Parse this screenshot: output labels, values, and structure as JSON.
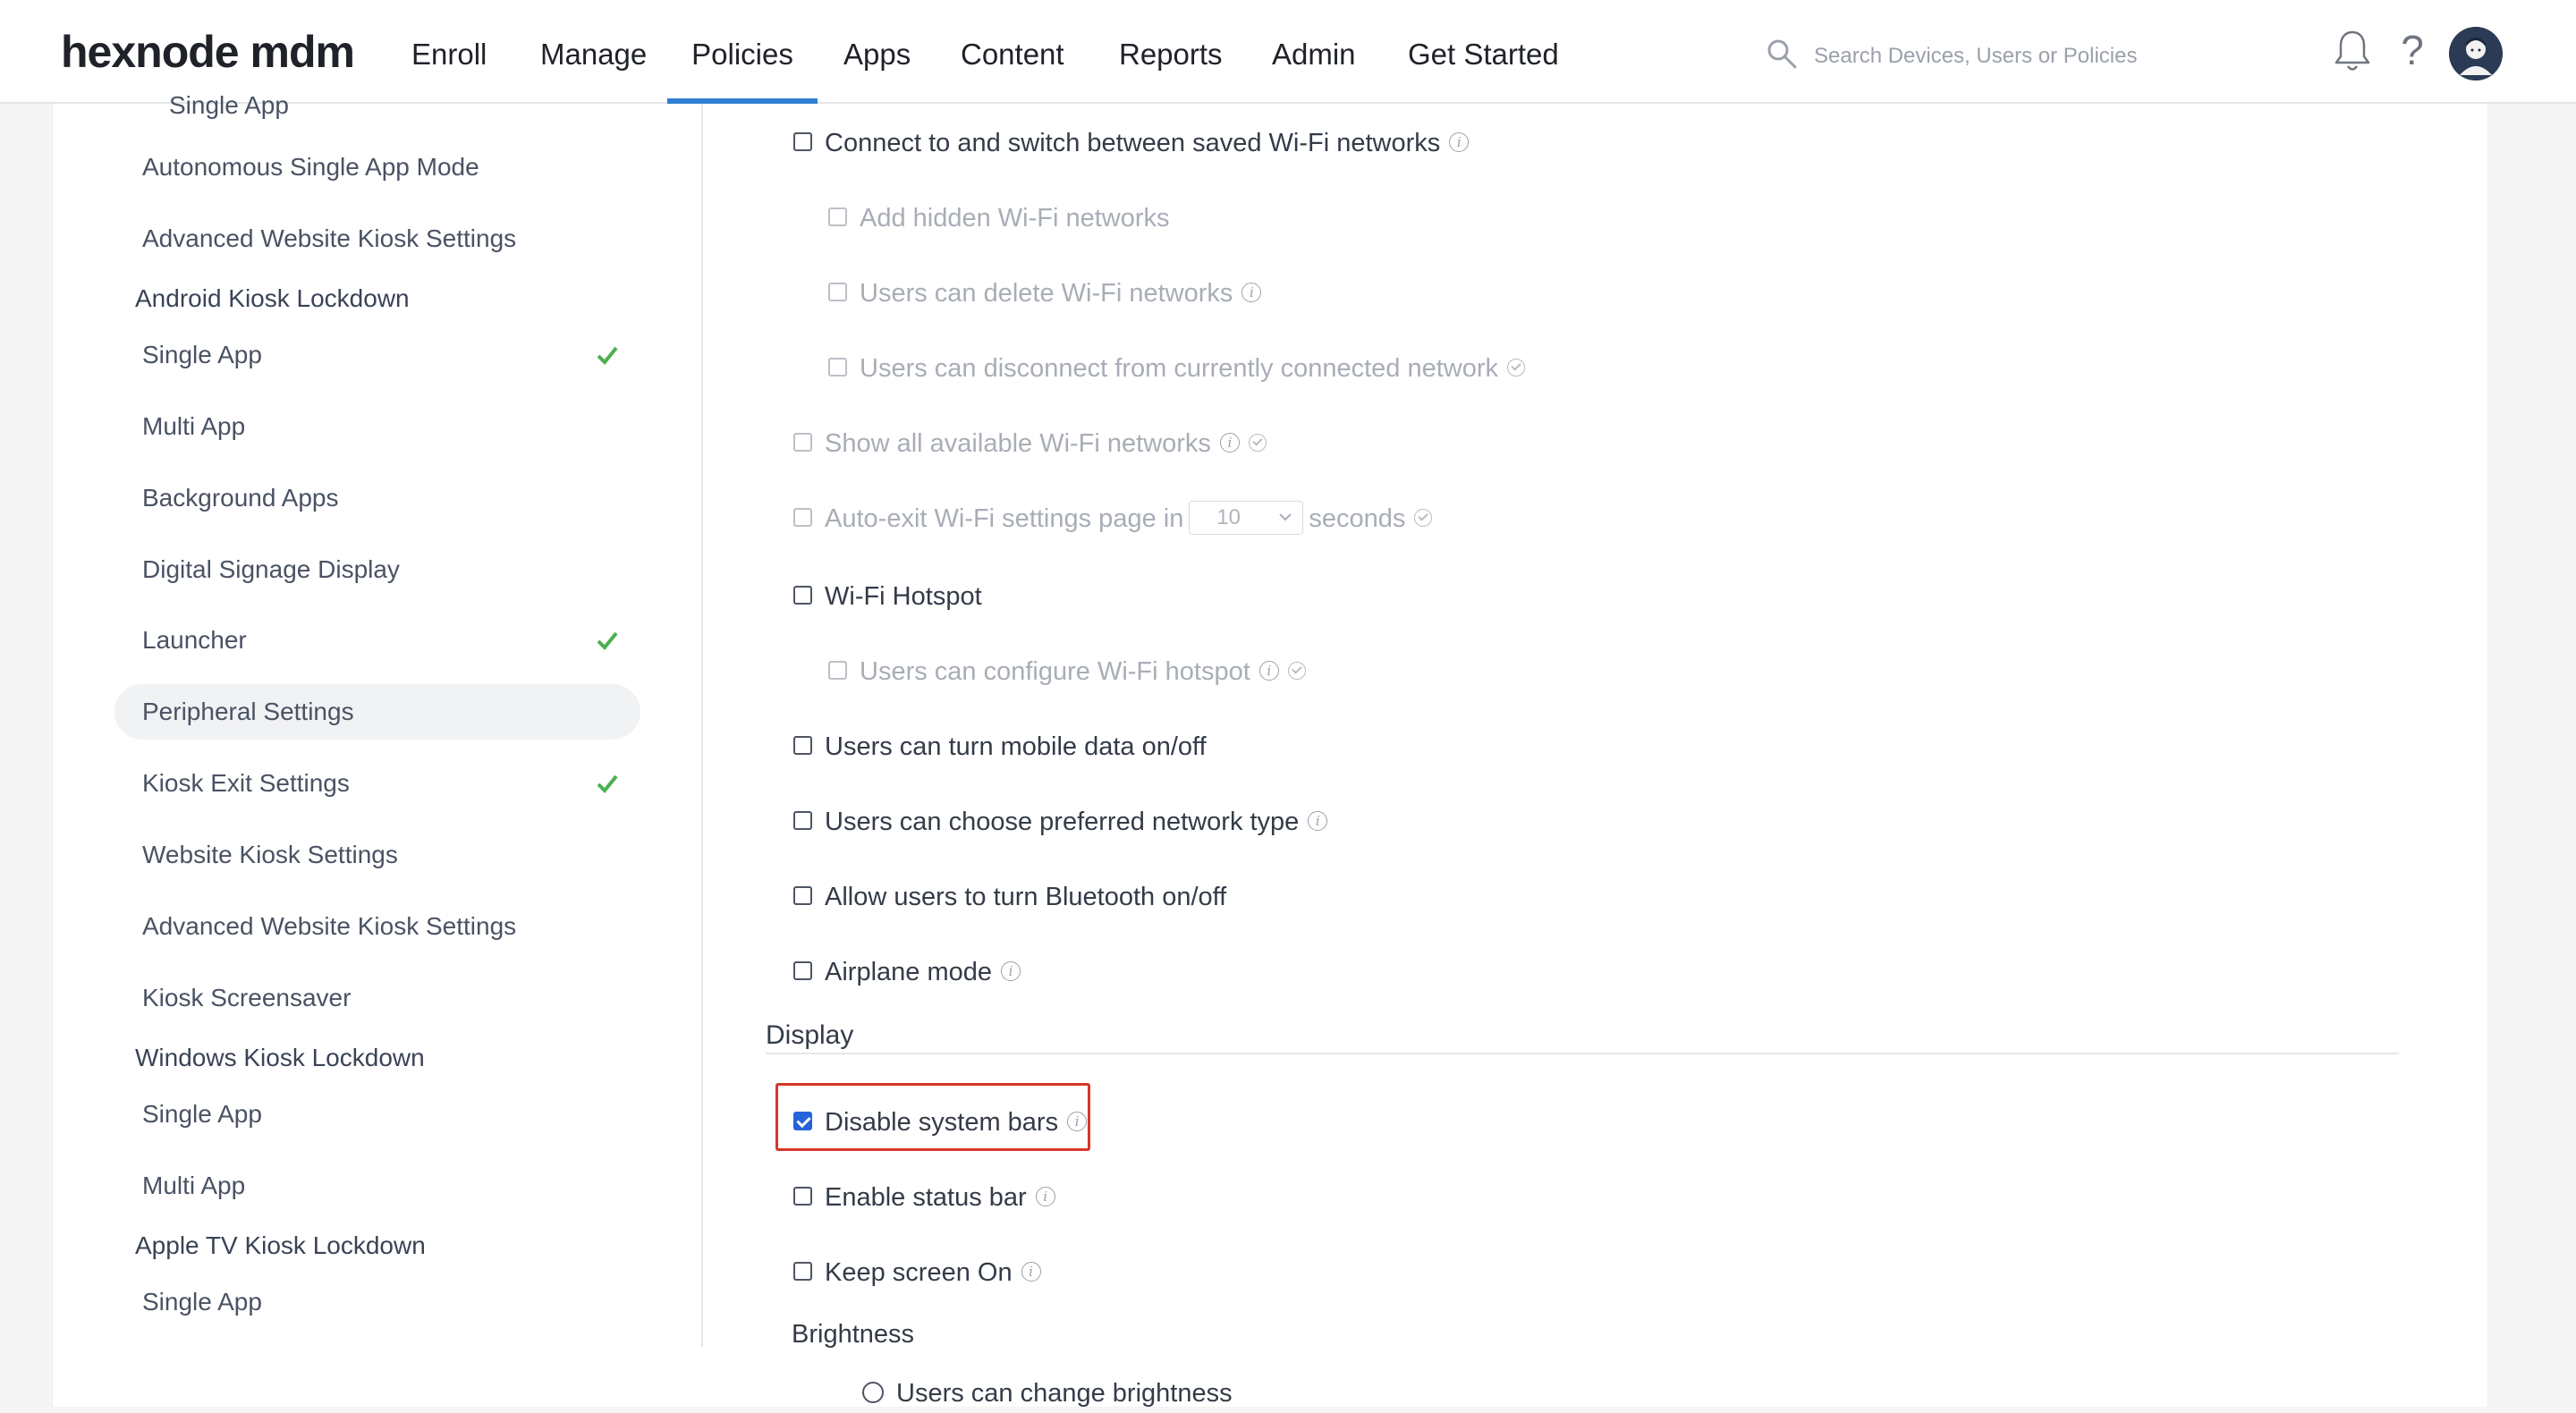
{
  "header": {
    "logo": "hexnode mdm",
    "nav": [
      "Enroll",
      "Manage",
      "Policies",
      "Apps",
      "Content",
      "Reports",
      "Admin",
      "Get Started"
    ],
    "active_nav": "Policies",
    "search_placeholder": "Search Devices, Users or Policies"
  },
  "sidebar": {
    "clipped_item": "Single App",
    "items": [
      {
        "label": "Autonomous Single App Mode"
      },
      {
        "label": "Advanced Website Kiosk Settings"
      },
      {
        "group": "Android Kiosk Lockdown"
      },
      {
        "label": "Single App",
        "configured": true
      },
      {
        "label": "Multi App"
      },
      {
        "label": "Background Apps"
      },
      {
        "label": "Digital Signage Display"
      },
      {
        "label": "Launcher",
        "configured": true
      },
      {
        "label": "Peripheral Settings",
        "selected": true
      },
      {
        "label": "Kiosk Exit Settings",
        "configured": true
      },
      {
        "label": "Website Kiosk Settings"
      },
      {
        "label": "Advanced Website Kiosk Settings"
      },
      {
        "label": "Kiosk Screensaver"
      },
      {
        "group": "Windows Kiosk Lockdown"
      },
      {
        "label": "Single App"
      },
      {
        "label": "Multi App"
      },
      {
        "group": "Apple TV Kiosk Lockdown"
      },
      {
        "label": "Single App"
      }
    ]
  },
  "settings": {
    "connect_wifi": "Connect to and switch between saved Wi-Fi networks",
    "add_hidden_wifi": "Add hidden Wi-Fi networks",
    "delete_wifi": "Users can delete Wi-Fi networks",
    "disconnect_network": "Users can disconnect from currently connected network",
    "show_wifi": "Show all available Wi-Fi networks",
    "auto_exit_prefix": "Auto-exit Wi-Fi settings page in",
    "auto_exit_value": "10",
    "auto_exit_suffix": "seconds",
    "wifi_hotspot": "Wi-Fi Hotspot",
    "configure_hotspot": "Users can configure Wi-Fi hotspot",
    "mobile_data": "Users can turn mobile data on/off",
    "network_type": "Users can choose preferred network type",
    "bluetooth": "Allow users to turn Bluetooth on/off",
    "airplane": "Airplane mode",
    "display_section": "Display",
    "disable_system_bars": "Disable system bars",
    "disable_system_bars_checked": true,
    "enable_status_bar": "Enable status bar",
    "keep_screen_on": "Keep screen On",
    "brightness_section": "Brightness",
    "change_brightness": "Users can change brightness"
  },
  "colors": {
    "accent": "#2f7fd3",
    "checkbox_checked": "#2563d9",
    "highlight_border": "#d9352b",
    "configured_check": "#4caf50"
  }
}
